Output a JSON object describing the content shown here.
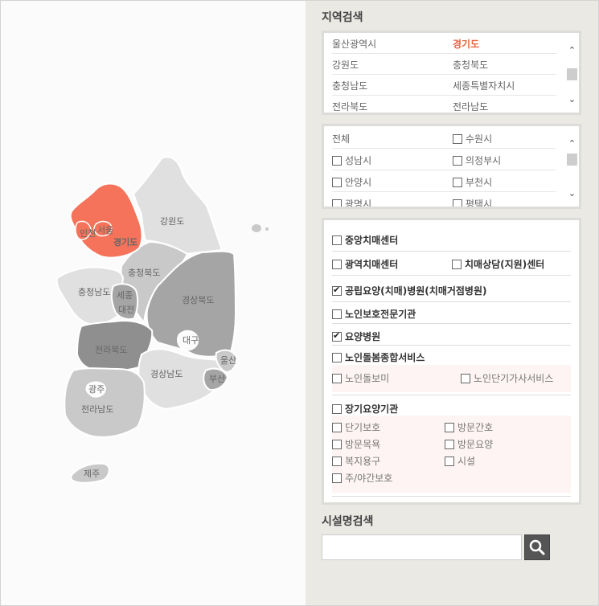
{
  "map": {
    "selected_region": "경기도",
    "labels": {
      "incheon": "인천",
      "seoul": "서울",
      "gyeonggi": "경기도",
      "gangwon": "강원도",
      "chungbuk": "충청북도",
      "chungnam": "충청남도",
      "sejong": "세종",
      "daejeon": "대전",
      "gyeongbuk": "경상북도",
      "daegu": "대구",
      "jeonbuk": "전라북도",
      "ulsan": "울산",
      "gyeongnam": "경상남도",
      "busan": "부산",
      "gwangju": "광주",
      "jeonnam": "전라남도",
      "jeju": "제주"
    },
    "colors": {
      "selected": "#f4735a",
      "light": "#e0e0e0",
      "mid": "#c9c9c9",
      "dark": "#a5a5a5",
      "darker": "#8f8f8f"
    }
  },
  "region_search": {
    "title": "지역검색",
    "rows": [
      [
        "울산광역시",
        "경기도"
      ],
      [
        "강원도",
        "충청북도"
      ],
      [
        "충청남도",
        "세종특별자치시"
      ],
      [
        "전라북도",
        "전라남도"
      ]
    ],
    "active": "경기도"
  },
  "city_list": {
    "all_label": "전체",
    "items": [
      "수원시",
      "성남시",
      "의정부시",
      "안양시",
      "부천시",
      "광명시",
      "평택시"
    ]
  },
  "facility_types": {
    "dementia_center": {
      "label": "중앙치매센터",
      "checked": false
    },
    "regional_dementia": {
      "label": "광역치매센터",
      "checked": false
    },
    "dementia_counsel": {
      "label": "치매상담(지원)센터",
      "checked": false
    },
    "public_hospital": {
      "label": "공립요양(치매)병원(치매거점병원)",
      "checked": true
    },
    "elder_protection": {
      "label": "노인보호전문기관",
      "checked": false
    },
    "nursing_hospital": {
      "label": "요양병원",
      "checked": true
    },
    "elder_care_service": {
      "label": "노인돌봄종합서비스",
      "checked": false
    },
    "elder_care_subs": [
      "노인돌보미",
      "노인단기가사서비스"
    ],
    "long_term_care": {
      "label": "장기요양기관",
      "checked": false
    },
    "long_term_subs": [
      "단기보호",
      "방문간호",
      "방문목욕",
      "방문요양",
      "복지용구",
      "시설",
      "주/야간보호"
    ]
  },
  "facility_search": {
    "title": "시설명검색",
    "placeholder": "",
    "button_icon": "search-icon"
  }
}
